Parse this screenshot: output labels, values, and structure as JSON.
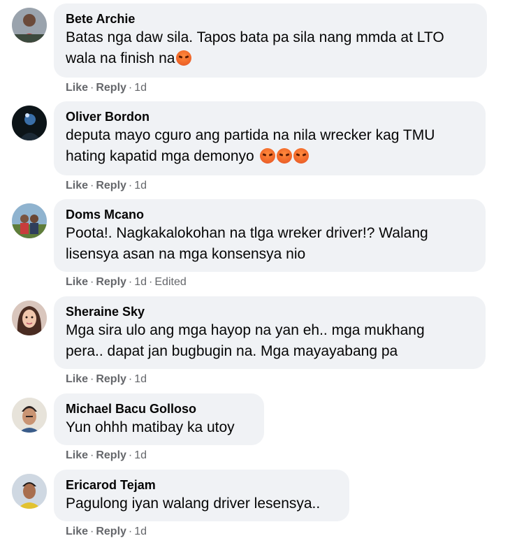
{
  "comments": [
    {
      "author": "Bete Archie",
      "text_line1": "Batas nga daw sila. Tapos bata pa sila nang mmda at LTO",
      "text_line2": "wala na finish na",
      "emoji": "angry-face-emoji",
      "like": "Like",
      "reply": "Reply",
      "time": "1d"
    },
    {
      "author": "Oliver Bordon",
      "text_line1": "deputa mayo cguro ang partida na nila wrecker kag TMU",
      "text_line2": "hating kapatid mga demonyo",
      "emoji": "angry-face-emoji",
      "emoji_count": 3,
      "like": "Like",
      "reply": "Reply",
      "time": "1d"
    },
    {
      "author": "Doms Mcano",
      "text_line1": "Poota!. Nagkakalokohan na tlga wreker driver!? Walang",
      "text_line2": "lisensya asan na mga konsensya nio",
      "like": "Like",
      "reply": "Reply",
      "time": "1d",
      "edited": "Edited"
    },
    {
      "author": "Sheraine Sky",
      "text_line1": "Mga sira ulo ang mga hayop na yan eh.. mga mukhang",
      "text_line2": "pera.. dapat jan bugbugin na. Mga mayayabang pa",
      "like": "Like",
      "reply": "Reply",
      "time": "1d"
    },
    {
      "author": "Michael Bacu Golloso",
      "text_line1": "Yun ohhh matibay ka utoy",
      "like": "Like",
      "reply": "Reply",
      "time": "1d"
    },
    {
      "author": "Ericarod Tejam",
      "text_line1": "Pagulong iyan walang driver lesensya..",
      "like": "Like",
      "reply": "Reply",
      "time": "1d"
    }
  ],
  "colors": {
    "bubble": "#f0f2f5",
    "text": "#050505",
    "meta": "#65676b",
    "emoji": "#f26a2a"
  }
}
